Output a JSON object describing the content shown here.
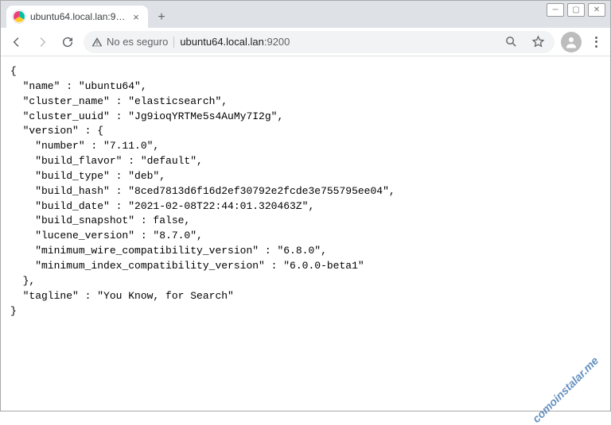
{
  "window": {
    "tab_title": "ubuntu64.local.lan:9200"
  },
  "toolbar": {
    "insecure_label": "No es seguro",
    "url_domain": "ubuntu64.local.lan",
    "url_port": ":9200"
  },
  "response": {
    "name": "ubuntu64",
    "cluster_name": "elasticsearch",
    "cluster_uuid": "Jg9ioqYRTMe5s4AuMy7I2g",
    "version": {
      "number": "7.11.0",
      "build_flavor": "default",
      "build_type": "deb",
      "build_hash": "8ced7813d6f16d2ef30792e2fcde3e755795ee04",
      "build_date": "2021-02-08T22:44:01.320463Z",
      "build_snapshot": false,
      "lucene_version": "8.7.0",
      "minimum_wire_compatibility_version": "6.8.0",
      "minimum_index_compatibility_version": "6.0.0-beta1"
    },
    "tagline": "You Know, for Search"
  },
  "watermark": "comoinstalar.me"
}
